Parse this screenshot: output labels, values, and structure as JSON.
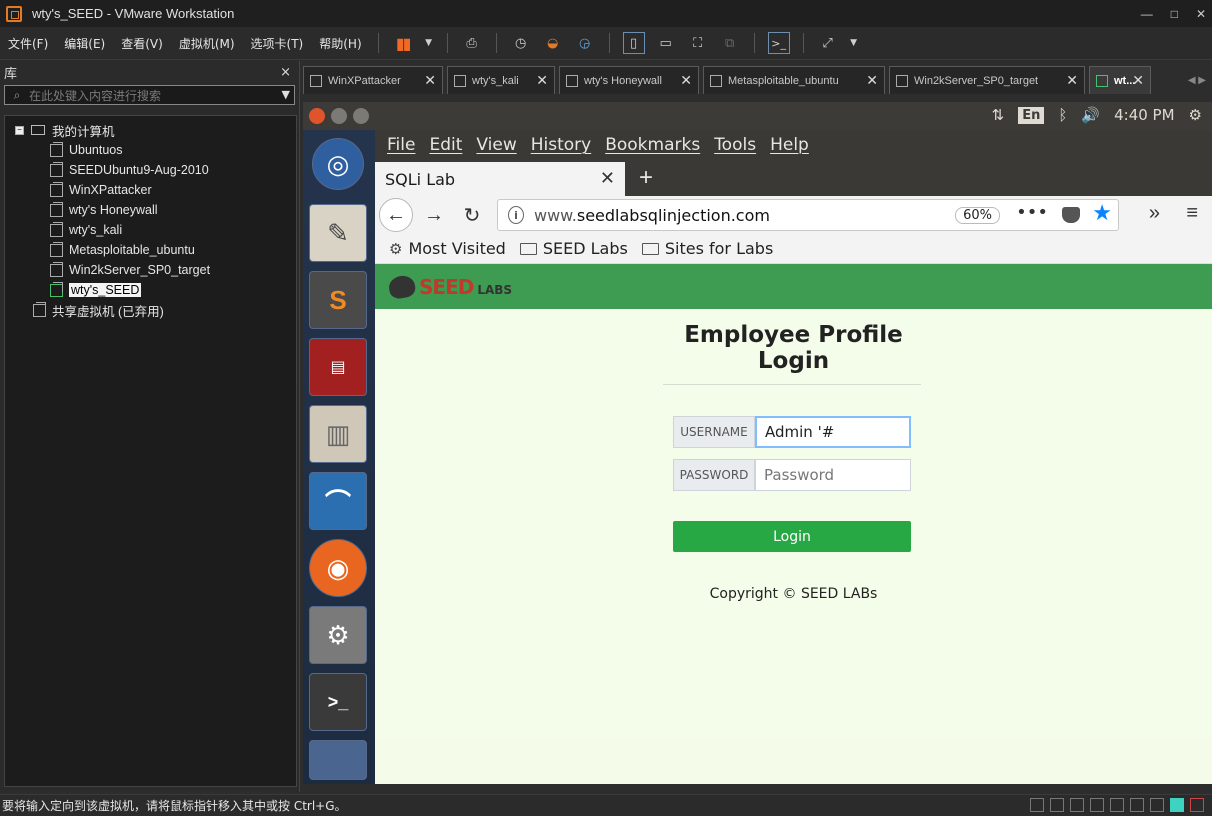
{
  "window": {
    "title": "wty's_SEED - VMware Workstation",
    "controls": [
      "—",
      "□",
      "✕"
    ]
  },
  "menubar": {
    "items": [
      "文件(F)",
      "编辑(E)",
      "查看(V)",
      "虚拟机(M)",
      "选项卡(T)",
      "帮助(H)"
    ],
    "toolbar_icons": [
      "pause-icon",
      "dropdown-icon",
      "send-keys-icon",
      "snapshot-icon",
      "revert-snapshot-icon",
      "snapshot-manager-icon",
      "show-library-icon",
      "console-view-icon",
      "fullscreen-icon",
      "unity-icon",
      "terminal-icon",
      "stretch-icon"
    ]
  },
  "library": {
    "title": "库",
    "close": "×",
    "search_placeholder": "在此处键入内容进行搜索",
    "root_label": "我的计算机",
    "vms": [
      "Ubuntuos",
      "SEEDUbuntu9-Aug-2010",
      "WinXPattacker",
      "wty's Honeywall",
      "wty's_kali",
      "Metasploitable_ubuntu",
      "Win2kServer_SP0_target",
      "wty's_SEED"
    ],
    "selected_vm": "wty's_SEED",
    "shared_label": "共享虚拟机 (已弃用)"
  },
  "tabs": [
    {
      "label": "WinXPattacker",
      "close": "✕"
    },
    {
      "label": "wty's_kali",
      "close": "✕"
    },
    {
      "label": "wty's Honeywall",
      "close": "✕"
    },
    {
      "label": "Metasploitable_ubuntu",
      "close": "✕"
    },
    {
      "label": "Win2kServer_SP0_target",
      "close": "✕"
    },
    {
      "label": "wt...",
      "close": "✕"
    }
  ],
  "tab_nav": "◀ ▶",
  "ubuntu": {
    "time": "4:40 PM",
    "keyboard": "En"
  },
  "firefox": {
    "menu": [
      "File",
      "Edit",
      "View",
      "History",
      "Bookmarks",
      "Tools",
      "Help"
    ],
    "tab_title": "SQLi Lab",
    "url_prefix": "www.",
    "url_host": "seedlabsqlinjection.com",
    "zoom": "60%",
    "bookmarks": [
      "Most Visited",
      "SEED Labs",
      "Sites for Labs"
    ]
  },
  "page": {
    "logo_main": "SEED",
    "logo_sub": "LABS",
    "title_line1": "Employee Profile",
    "title_line2": "Login",
    "username_label": "USERNAME",
    "username_value": "Admin '#",
    "password_label": "PASSWORD",
    "password_placeholder": "Password",
    "login_button": "Login",
    "copyright": "Copyright © SEED LABs"
  },
  "statusbar": {
    "message": "要将输入定向到该虚拟机，请将鼠标指针移入其中或按 Ctrl+G。"
  }
}
